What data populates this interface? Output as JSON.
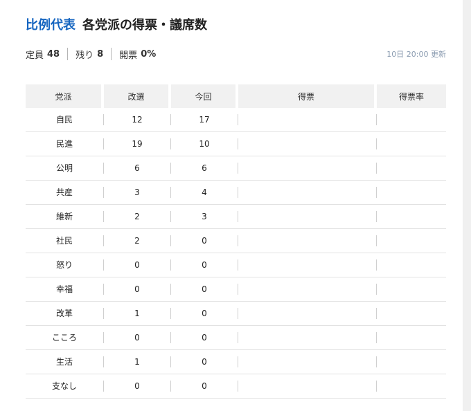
{
  "header": {
    "title_accent": "比例代表",
    "title_main": "各党派の得票・議席数"
  },
  "stats": {
    "quota_label": "定員",
    "quota_value": "48",
    "remaining_label": "残り",
    "remaining_value": "8",
    "counted_label": "開票",
    "counted_value": "0%",
    "updated": "10日 20:00 更新"
  },
  "table": {
    "columns": [
      "党派",
      "改選",
      "今回",
      "得票",
      "得票率"
    ],
    "rows": [
      {
        "party": "自民",
        "before": "12",
        "now": "17",
        "votes": "",
        "rate": ""
      },
      {
        "party": "民進",
        "before": "19",
        "now": "10",
        "votes": "",
        "rate": ""
      },
      {
        "party": "公明",
        "before": "6",
        "now": "6",
        "votes": "",
        "rate": ""
      },
      {
        "party": "共産",
        "before": "3",
        "now": "4",
        "votes": "",
        "rate": ""
      },
      {
        "party": "維新",
        "before": "2",
        "now": "3",
        "votes": "",
        "rate": ""
      },
      {
        "party": "社民",
        "before": "2",
        "now": "0",
        "votes": "",
        "rate": ""
      },
      {
        "party": "怒り",
        "before": "0",
        "now": "0",
        "votes": "",
        "rate": ""
      },
      {
        "party": "幸福",
        "before": "0",
        "now": "0",
        "votes": "",
        "rate": ""
      },
      {
        "party": "改革",
        "before": "1",
        "now": "0",
        "votes": "",
        "rate": ""
      },
      {
        "party": "こころ",
        "before": "0",
        "now": "0",
        "votes": "",
        "rate": ""
      },
      {
        "party": "生活",
        "before": "1",
        "now": "0",
        "votes": "",
        "rate": ""
      },
      {
        "party": "支なし",
        "before": "0",
        "now": "0",
        "votes": "",
        "rate": ""
      }
    ]
  },
  "colors": {
    "accent": "#1565c0",
    "header_bg": "#f1f1f1",
    "updated_text": "#8a9bb0"
  }
}
